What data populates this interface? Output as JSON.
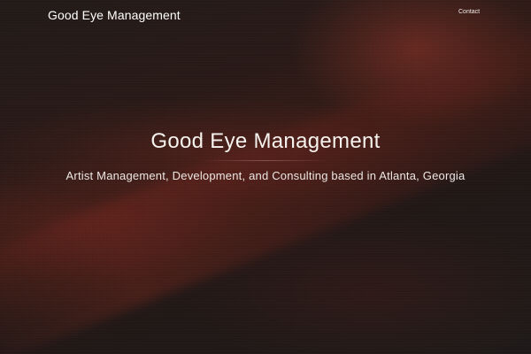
{
  "header": {
    "site_title": "Good Eye Management",
    "nav": [
      {
        "label": "Contact"
      }
    ]
  },
  "hero": {
    "title": "Good Eye Management",
    "subtitle": "Artist Management, Development, and Consulting based in Atlanta, Georgia"
  },
  "colors": {
    "background": "#1b1716",
    "accent_red": "#96372a",
    "text": "#f3efec"
  }
}
